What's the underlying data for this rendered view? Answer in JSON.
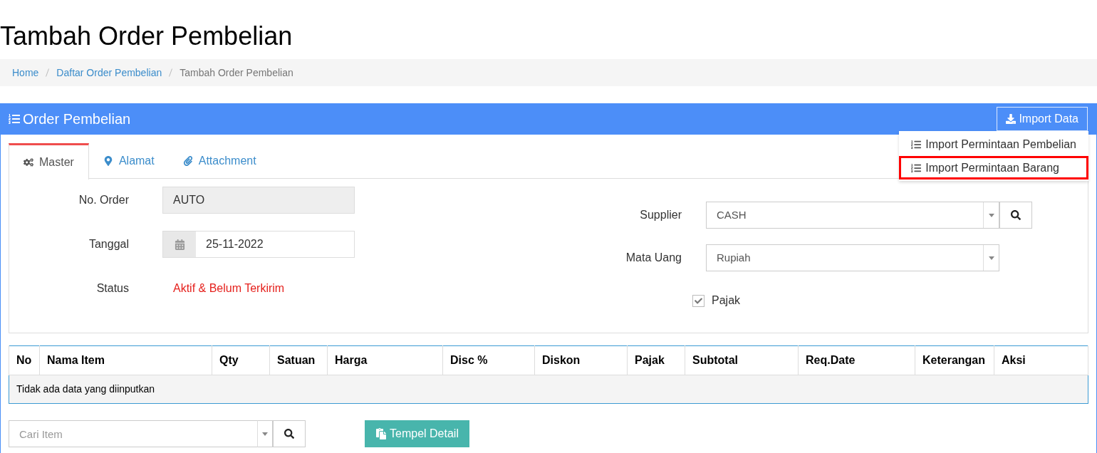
{
  "page_title": "Tambah Order Pembelian",
  "breadcrumb": [
    {
      "label": "Home",
      "current": false
    },
    {
      "label": "Daftar Order Pembelian",
      "current": false
    },
    {
      "label": "Tambah Order Pembelian",
      "current": true
    }
  ],
  "panel": {
    "title": "Order Pembelian",
    "import_button": "Import Data",
    "import_menu": [
      {
        "label": "Import Permintaan Pembelian",
        "selected": false
      },
      {
        "label": "Import Permintaan Barang",
        "selected": true
      }
    ]
  },
  "tabs": [
    {
      "label": "Master",
      "selected": true
    },
    {
      "label": "Alamat",
      "selected": false
    },
    {
      "label": "Attachment",
      "selected": false
    }
  ],
  "form_left": [
    {
      "label": "No. Order",
      "kind": "readonly",
      "value": "AUTO"
    },
    {
      "label": "Tanggal",
      "kind": "date",
      "value": "25-11-2022"
    },
    {
      "label": "Status",
      "kind": "status",
      "value": "Aktif & Belum Terkirim"
    }
  ],
  "form_right": [
    {
      "label": "Supplier",
      "kind": "select-search",
      "value": "CASH"
    },
    {
      "label": "Mata Uang",
      "kind": "select",
      "value": "Rupiah"
    },
    {
      "label": "Pajak",
      "kind": "checkbox",
      "checked": true
    }
  ],
  "table": {
    "columns": [
      "No",
      "Nama Item",
      "Qty",
      "Satuan",
      "Harga",
      "Disc %",
      "Diskon",
      "Pajak",
      "Subtotal",
      "Req.Date",
      "Keterangan",
      "Aksi"
    ],
    "empty_message": "Tidak ada data yang diinputkan"
  },
  "item_search": {
    "placeholder": "Cari Item"
  },
  "paste_button": "Tempel Detail"
}
